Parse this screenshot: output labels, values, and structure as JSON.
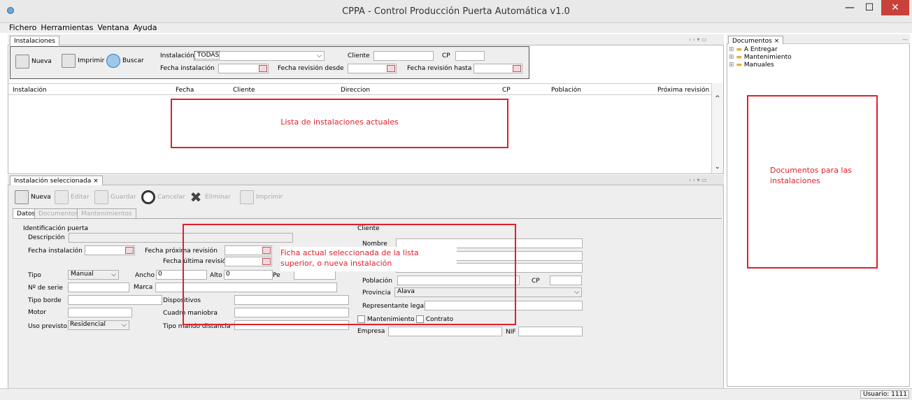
{
  "window": {
    "title": "CPPA - Control Producción Puerta Automática v1.0"
  },
  "menu": [
    "Fichero",
    "Herramientas",
    "Ventana",
    "Ayuda"
  ],
  "instalaciones_panel": {
    "tab": "Instalaciones",
    "toolbar": {
      "nueva": "Nueva",
      "imprimir": "Imprimir",
      "buscar": "Buscar"
    },
    "filters": {
      "instalacion_label": "Instalación",
      "instalacion_value": "TODAS",
      "cliente_label": "Cliente",
      "cp_label": "CP",
      "fecha_instalacion_label": "Fecha instalación",
      "fecha_revision_desde_label": "Fecha revisión desde",
      "fecha_revision_hasta_label": "Fecha revisión hasta"
    },
    "columns": [
      "Instalación",
      "Fecha",
      "Cliente",
      "Direccion",
      "CP",
      "Población",
      "Próxima revisión"
    ],
    "annotation": "Lista de instalaciones actuales"
  },
  "seleccionada_panel": {
    "tab": "Instalación seleccionada",
    "toolbar": {
      "nueva": "Nueva",
      "editar": "Editar",
      "guardar": "Guardar",
      "cancelar": "Cancelar",
      "eliminar": "Eliminar",
      "imprimir": "Imprimir"
    },
    "subtabs": [
      "Datos",
      "Documentos",
      "Mantenimientos"
    ],
    "identificacion": {
      "group": "Identificación puerta",
      "descripcion": "Descripción",
      "fecha_instalacion": "Fecha instalación",
      "fecha_proxima_revision": "Fecha próxima revisión",
      "fecha_ultima_revision": "Fecha última revisión",
      "tipo": "Tipo",
      "tipo_value": "Manual",
      "ancho": "Ancho",
      "ancho_value": "0",
      "alto": "Alto",
      "alto_value": "0",
      "peso": "Pe",
      "nserie": "Nº de serie",
      "marca": "Marca",
      "tipo_borde": "Tipo borde",
      "dispositivos": "Dispositivos",
      "motor": "Motor",
      "cuadro_maniobra": "Cuadro maniobra",
      "uso_previsto": "Uso previsto",
      "uso_value": "Residencial",
      "tipo_mando": "Tipo mando distancia"
    },
    "cliente": {
      "group": "Cliente",
      "nombre": "Nombre",
      "poblacion": "Población",
      "cp": "CP",
      "provincia": "Provincia",
      "provincia_value": "Alava",
      "representante": "Representante legal",
      "mantenimiento": "Mantenimiento",
      "contrato": "Contrato",
      "empresa": "Empresa",
      "nif": "NIF"
    },
    "annotation_line1": "Ficha actual seleccionada de la lista",
    "annotation_line2": "superior, o nueva instalación"
  },
  "documentos_panel": {
    "tab": "Documentos",
    "tree": [
      "A Entregar",
      "Mantenimiento",
      "Manuales"
    ],
    "annotation_line1": "Documentos para las",
    "annotation_line2": "instalaciones"
  },
  "status": {
    "usuario": "Usuario: 1111"
  }
}
